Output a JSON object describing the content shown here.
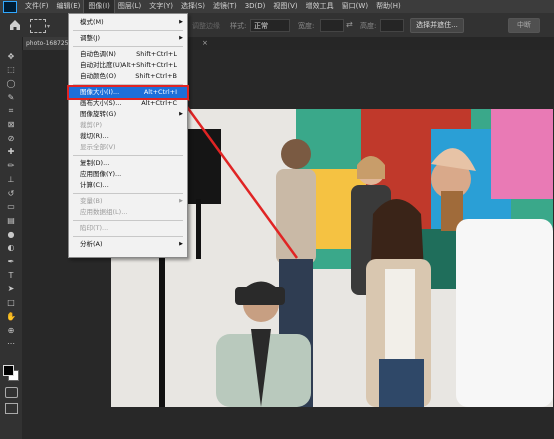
{
  "menubar": {
    "items": [
      "文件(F)",
      "编辑(E)",
      "图像(I)",
      "图层(L)",
      "文字(Y)",
      "选择(S)",
      "滤镜(T)",
      "3D(D)",
      "视图(V)",
      "增效工具",
      "窗口(W)",
      "帮助(H)"
    ],
    "active_index": 2
  },
  "options": {
    "width_label": "宽度:",
    "height_label": "高度:",
    "style_label": "样式:",
    "style_value": "正常",
    "adjust_edge": "调整边缘",
    "select_subject": "选择并遮住...",
    "cancel": "中断"
  },
  "document": {
    "tab_title": "photo-168725",
    "tab_close": "×"
  },
  "image_menu": {
    "items": [
      {
        "label": "模式(M)",
        "shortcut": "",
        "submenu": true,
        "disabled": false
      },
      {
        "sep": true
      },
      {
        "label": "调整(J)",
        "shortcut": "",
        "submenu": true,
        "disabled": false
      },
      {
        "sep": true
      },
      {
        "label": "自动色调(N)",
        "shortcut": "Shift+Ctrl+L",
        "submenu": false,
        "disabled": false
      },
      {
        "label": "自动对比度(U)",
        "shortcut": "Alt+Shift+Ctrl+L",
        "submenu": false,
        "disabled": false
      },
      {
        "label": "自动颜色(O)",
        "shortcut": "Shift+Ctrl+B",
        "submenu": false,
        "disabled": false
      },
      {
        "sep": true
      },
      {
        "label": "图像大小(I)...",
        "shortcut": "Alt+Ctrl+I",
        "submenu": false,
        "disabled": false,
        "highlighted": true
      },
      {
        "label": "画布大小(S)...",
        "shortcut": "Alt+Ctrl+C",
        "submenu": false,
        "disabled": false
      },
      {
        "label": "图像旋转(G)",
        "shortcut": "",
        "submenu": true,
        "disabled": false
      },
      {
        "label": "裁剪(P)",
        "shortcut": "",
        "submenu": false,
        "disabled": true
      },
      {
        "label": "裁切(R)...",
        "shortcut": "",
        "submenu": false,
        "disabled": false
      },
      {
        "label": "显示全部(V)",
        "shortcut": "",
        "submenu": false,
        "disabled": true
      },
      {
        "sep": true
      },
      {
        "label": "复制(D)...",
        "shortcut": "",
        "submenu": false,
        "disabled": false
      },
      {
        "label": "应用图像(Y)...",
        "shortcut": "",
        "submenu": false,
        "disabled": false
      },
      {
        "label": "计算(C)...",
        "shortcut": "",
        "submenu": false,
        "disabled": false
      },
      {
        "sep": true
      },
      {
        "label": "变量(B)",
        "shortcut": "",
        "submenu": true,
        "disabled": true
      },
      {
        "label": "应用数据组(L)...",
        "shortcut": "",
        "submenu": false,
        "disabled": true
      },
      {
        "sep": true
      },
      {
        "label": "陷印(T)...",
        "shortcut": "",
        "submenu": false,
        "disabled": true
      },
      {
        "sep": true
      },
      {
        "label": "分析(A)",
        "shortcut": "",
        "submenu": true,
        "disabled": false
      }
    ]
  },
  "tools": [
    "move-tool",
    "marquee-tool",
    "lasso-tool",
    "quick-select-tool",
    "crop-tool",
    "frame-tool",
    "eyedropper-tool",
    "healing-tool",
    "brush-tool",
    "stamp-tool",
    "history-brush-tool",
    "eraser-tool",
    "gradient-tool",
    "blur-tool",
    "dodge-tool",
    "pen-tool",
    "type-tool",
    "path-select-tool",
    "rectangle-tool",
    "hand-tool",
    "zoom-tool",
    "more-tools"
  ],
  "colors": {
    "accent": "#1e6fd9",
    "annotation": "#e02424"
  }
}
